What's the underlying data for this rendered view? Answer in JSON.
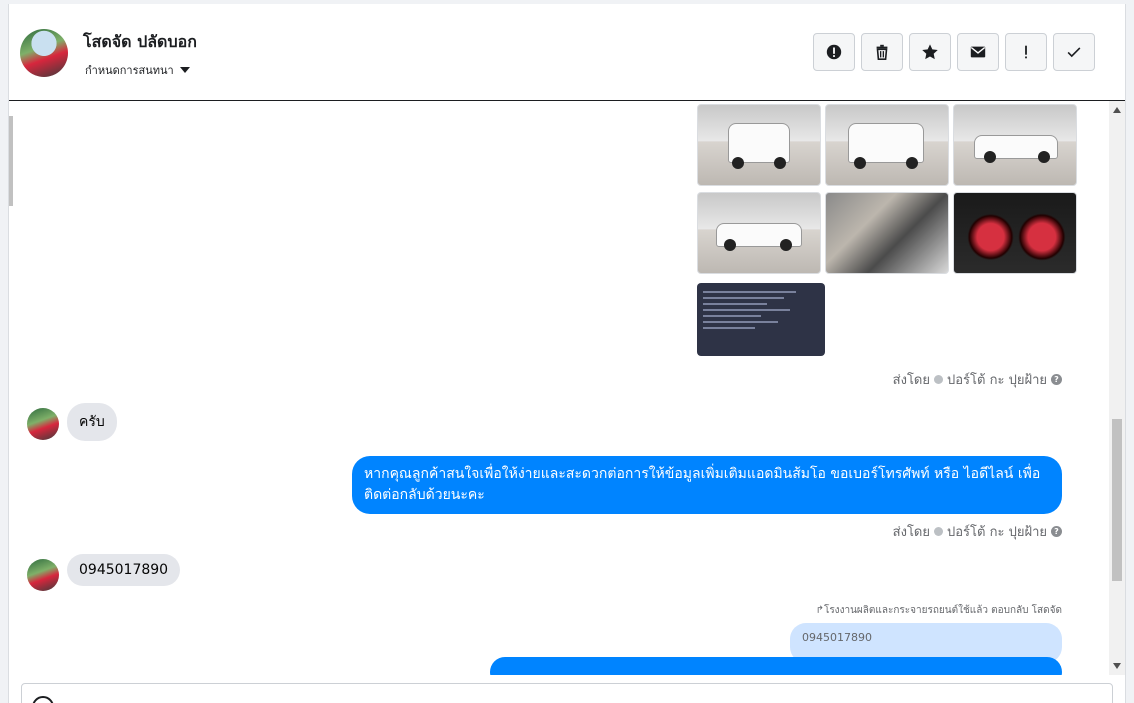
{
  "header": {
    "contact_name": "โสดจัด ปลัดบอก",
    "assign_label": "กำหนดการสนทนา",
    "actions": [
      {
        "name": "spam-icon"
      },
      {
        "name": "trash-icon"
      },
      {
        "name": "star-icon"
      },
      {
        "name": "mail-icon"
      },
      {
        "name": "important-icon"
      },
      {
        "name": "check-icon"
      }
    ]
  },
  "thread": {
    "sent_by_prefix": "ส่งโดย",
    "sent_by_name": "ปอร์โต้ กะ ปุยฝ้าย",
    "msg_in_1": "ครับ",
    "msg_out_1": "หากคุณลูกค้าสนใจเพื่อให้ง่ายและสะดวกต่อการให้ข้อมูลเพิ่มเติมแอดมินส้มโอ ขอเบอร์โทรศัพท์ หรือ ไอดีไลน์ เพื่อติดต่อกลับด้วยนะคะ",
    "msg_in_2": "0945017890",
    "reply_note": "↱โรงงานผลิตและกระจายรถยนต์ใช้แล้ว ตอบกลับ โสดจัด",
    "quoted_text": "0945017890"
  },
  "colors": {
    "accent_blue": "#0084ff",
    "incoming_bubble": "#e4e6eb",
    "quoted_bubble": "#cfe4ff"
  }
}
